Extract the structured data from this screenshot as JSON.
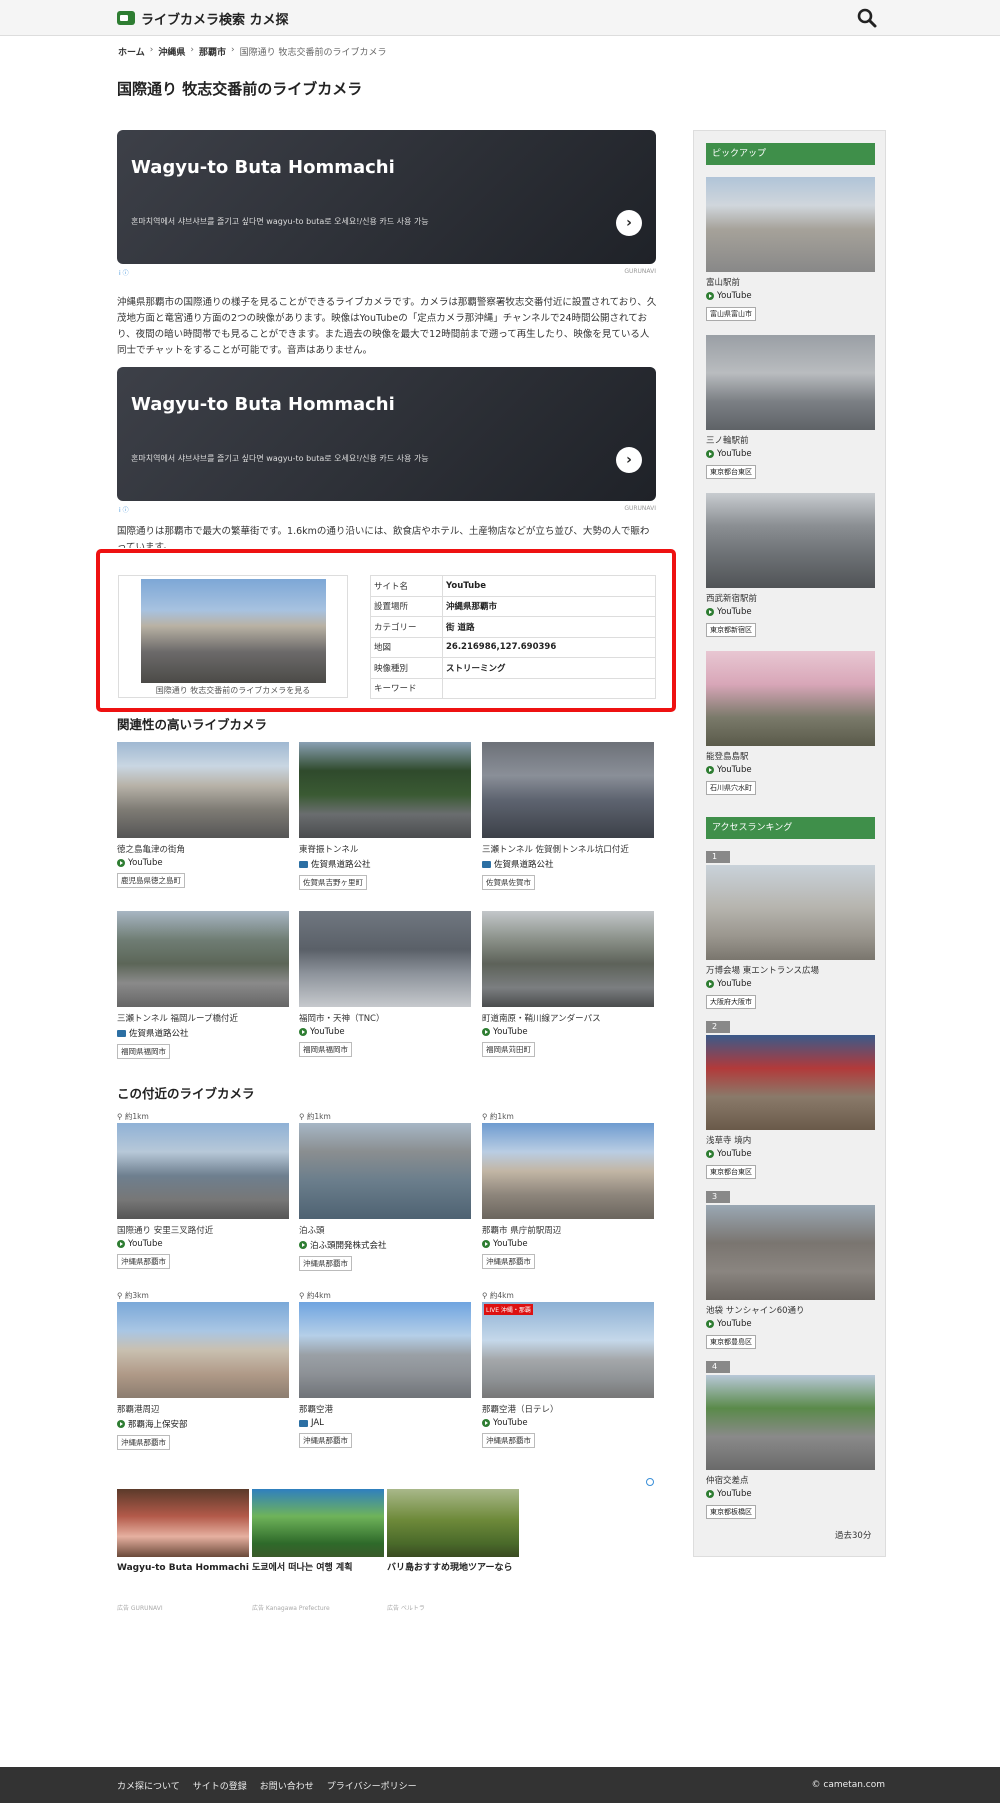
{
  "header": {
    "site_name": "ライブカメラ検索 カメ探"
  },
  "breadcrumb": [
    "ホーム",
    "沖縄県",
    "那覇市",
    "国際通り 牧志交番前のライブカメラ"
  ],
  "page_title": "国際通り 牧志交番前のライブカメラ",
  "ad1": {
    "title": "Wagyu-to Buta Hommachi",
    "subtitle": "혼마치역에서 샤브샤브를 즐기고 싶다면 wagyu-to buta로 오세요!/신용 카드 사용 가능",
    "info": "i ⓘ",
    "source": "GURUNAVI"
  },
  "ad2": {
    "title": "Wagyu-to Buta Hommachi",
    "subtitle": "혼마치역에서 샤브샤브를 즐기고 싶다면 wagyu-to buta로 오세요!/신용 카드 사용 가능",
    "info": "i ⓘ",
    "source": "GURUNAVI"
  },
  "description1": "沖縄県那覇市の国際通りの様子を見ることができるライブカメラです。カメラは那覇警察署牧志交番付近に設置されており、久茂地方面と竜宮通り方面の2つの映像があります。映像はYouTubeの「定点カメラ那沖縄」チャンネルで24時間公開されており、夜間の暗い時間帯でも見ることができます。また過去の映像を最大で12時間前まで遡って再生したり、映像を見ている人同士でチャットをすることが可能です。音声はありません。",
  "description2": "国際通りは那覇市で最大の繁華街です。1.6kmの通り沿いには、飲食店やホテル、土産物店などが立ち並び、大勢の人で賑わっています。",
  "camera_info": {
    "thumb_caption": "国際通り 牧志交番前のライブカメラを見る",
    "rows": [
      {
        "k": "サイト名",
        "v": "YouTube"
      },
      {
        "k": "設置場所",
        "v": "沖縄県那覇市"
      },
      {
        "k": "カテゴリー",
        "v": "街 道路"
      },
      {
        "k": "地図",
        "v": "26.216986,127.690396"
      },
      {
        "k": "映像種別",
        "v": "ストリーミング"
      },
      {
        "k": "キーワード",
        "v": ""
      }
    ]
  },
  "related_title": "関連性の高いライブカメラ",
  "related": [
    {
      "name": "徳之島亀津の街角",
      "source": "YouTube",
      "src_type": "youtube",
      "tag": "鹿児島県徳之島町"
    },
    {
      "name": "東脊振トンネル",
      "source": "佐賀県道路公社",
      "src_type": "camera",
      "tag": "佐賀県吉野ヶ里町"
    },
    {
      "name": "三瀬トンネル 佐賀側トンネル坑口付近",
      "source": "佐賀県道路公社",
      "src_type": "camera",
      "tag": "佐賀県佐賀市"
    },
    {
      "name": "三瀬トンネル 福岡ループ橋付近",
      "source": "佐賀県道路公社",
      "src_type": "camera",
      "tag": "福岡県福岡市"
    },
    {
      "name": "福岡市・天神（TNC）",
      "source": "YouTube",
      "src_type": "youtube",
      "tag": "福岡県福岡市"
    },
    {
      "name": "町道南原・鞘川線アンダーパス",
      "source": "YouTube",
      "src_type": "youtube",
      "tag": "福岡県苅田町"
    }
  ],
  "nearby_title": "この付近のライブカメラ",
  "nearby": [
    {
      "dist": "約1km",
      "name": "国際通り 安里三叉路付近",
      "source": "YouTube",
      "src_type": "youtube",
      "tag": "沖縄県那覇市"
    },
    {
      "dist": "約1km",
      "name": "泊ふ頭",
      "source": "泊ふ頭開発株式会社",
      "src_type": "youtube",
      "tag": "沖縄県那覇市"
    },
    {
      "dist": "約1km",
      "name": "那覇市 県庁前駅周辺",
      "source": "YouTube",
      "src_type": "youtube",
      "tag": "沖縄県那覇市"
    },
    {
      "dist": "約3km",
      "name": "那覇港周辺",
      "source": "那覇海上保安部",
      "src_type": "youtube",
      "tag": "沖縄県那覇市"
    },
    {
      "dist": "約4km",
      "name": "那覇空港",
      "source": "JAL",
      "src_type": "camera",
      "tag": "沖縄県那覇市"
    },
    {
      "dist": "約4km",
      "name": "那覇空港（日テレ）",
      "source": "YouTube",
      "src_type": "youtube",
      "tag": "沖縄県那覇市"
    }
  ],
  "live_badge": "LIVE 沖縄・那覇",
  "recommendations": [
    {
      "title": "Wagyu-to Buta Hommachi",
      "meta": "広告 GURUNAVI"
    },
    {
      "title": "도쿄에서 떠나는 여행 계획",
      "meta": "広告 Kanagawa Prefecture"
    },
    {
      "title": "バリ島おすすめ現地ツアーなら",
      "meta": "広告 ベルトラ"
    }
  ],
  "sidebar": {
    "pickup_title": "ピックアップ",
    "pickup": [
      {
        "name": "富山駅前",
        "source": "YouTube",
        "tag": "富山県富山市"
      },
      {
        "name": "三ノ輪駅前",
        "source": "YouTube",
        "tag": "東京都台東区"
      },
      {
        "name": "西武新宿駅前",
        "source": "YouTube",
        "tag": "東京都新宿区"
      },
      {
        "name": "能登島島駅",
        "source": "YouTube",
        "tag": "石川県穴水町"
      }
    ],
    "ranking_title": "アクセスランキング",
    "ranking": [
      {
        "rank": "1",
        "name": "万博会場 東エントランス広場",
        "source": "YouTube",
        "tag": "大阪府大阪市"
      },
      {
        "rank": "2",
        "name": "浅草寺 境内",
        "source": "YouTube",
        "tag": "東京都台東区"
      },
      {
        "rank": "3",
        "name": "池袋 サンシャイン60通り",
        "source": "YouTube",
        "tag": "東京都豊島区"
      },
      {
        "rank": "4",
        "name": "仲宿交差点",
        "source": "YouTube",
        "tag": "東京都板橋区"
      }
    ],
    "period": "過去30分"
  },
  "footer": {
    "links": [
      "カメ探について",
      "サイトの登録",
      "お問い合わせ",
      "プライバシーポリシー"
    ],
    "copyright": "© cametan.com"
  }
}
